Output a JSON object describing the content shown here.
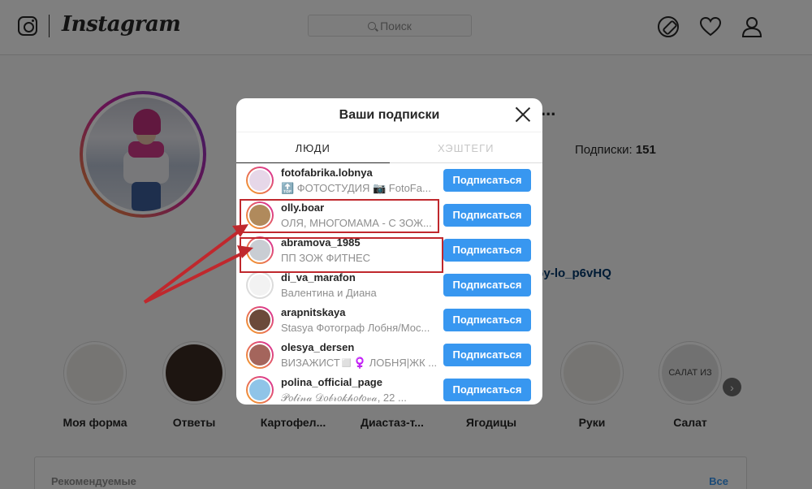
{
  "nav": {
    "brand": "Instagram",
    "search_placeholder": "Поиск",
    "icons": [
      "instagram-camera-icon",
      "compass-icon",
      "heart-icon",
      "user-icon"
    ]
  },
  "profile": {
    "username_suffix": "...",
    "following_label": "Подписки:",
    "following_count": "151",
    "link_fragment": "rGy-lo_p6vHQ"
  },
  "highlights": [
    {
      "label": "Моя форма"
    },
    {
      "label": "Ответы"
    },
    {
      "label": "Картофел..."
    },
    {
      "label": "Диастаз-т..."
    },
    {
      "label": "Ягодицы"
    },
    {
      "label": "Руки"
    },
    {
      "label": "Салат"
    }
  ],
  "highlight_salat_text": "САЛАТ ИЗ",
  "recommended": {
    "title": "Рекомендуемые",
    "all": "Все"
  },
  "modal": {
    "title": "Ваши подписки",
    "tabs": {
      "people": "ЛЮДИ",
      "hashtags": "ХЭШТЕГИ"
    },
    "rows": [
      {
        "name": "fotofabrika.lobnya",
        "sub": "🔝 ФОТОСТУДИЯ 📷 FotoFa...",
        "button": "Подписаться",
        "avatar_color": "#e6d7e8"
      },
      {
        "name": "olly.boar",
        "sub": "ОЛЯ, МНОГОМАМА - С ЗОЖ...",
        "button": "Подписаться",
        "avatar_color": "#b08a5c"
      },
      {
        "name": "abramova_1985",
        "sub": "ПП ЗОЖ ФИТНЕС",
        "button": "Подписаться",
        "avatar_color": "#c9cdd3"
      },
      {
        "name": "di_va_marafon",
        "sub": "Валентина и Диана",
        "button": "Подписаться",
        "avatar_color": "#f2f2f2"
      },
      {
        "name": "arapnitskaya",
        "sub": "Stasya Фотограф Лобня/Мос...",
        "button": "Подписаться",
        "avatar_color": "#6b4a3a"
      },
      {
        "name": "olesya_dersen",
        "sub": "ВИЗАЖИСТ◻️♀️ ЛОБНЯ|ЖК ...",
        "button": "Подписаться",
        "avatar_color": "#a4655c"
      },
      {
        "name": "polina_official_page",
        "sub": "𝒫𝑜𝓁𝒾𝓃𝒶 𝒟𝑜𝒷𝓇𝑜𝓀𝒽𝑜𝓉𝑜𝓋𝒶, 22 ...",
        "button": "Подписаться",
        "avatar_color": "#8fc4e8"
      }
    ]
  },
  "colors": {
    "accent": "#3897f0",
    "annotation": "#c0282d"
  }
}
